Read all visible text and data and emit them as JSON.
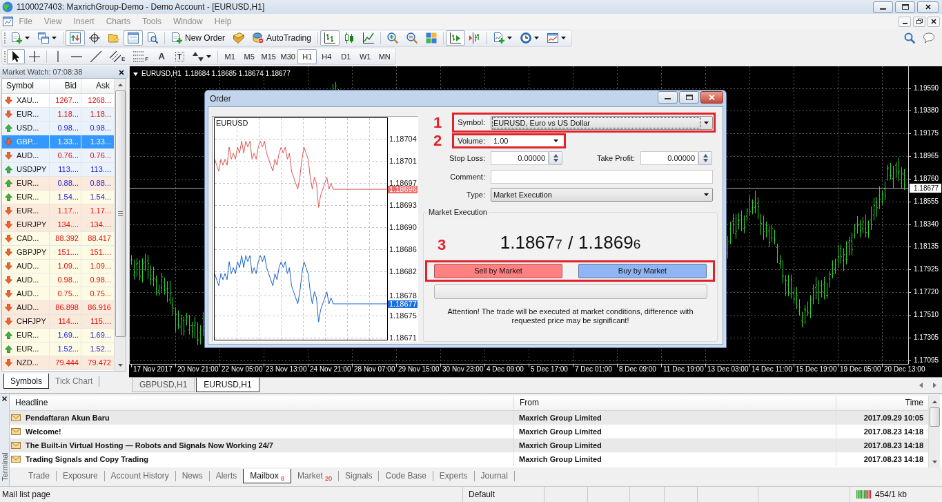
{
  "window": {
    "title": "1100027403: MaxrichGroup-Demo - Demo Account - [EURUSD,H1]"
  },
  "menu": [
    {
      "label": "File",
      "disabled": true
    },
    {
      "label": "View",
      "disabled": true
    },
    {
      "label": "Insert",
      "disabled": true
    },
    {
      "label": "Charts",
      "disabled": true
    },
    {
      "label": "Tools",
      "disabled": true
    },
    {
      "label": "Window",
      "disabled": true
    },
    {
      "label": "Help",
      "disabled": true
    }
  ],
  "main_toolbar": [
    [
      {
        "kind": "icon",
        "pressed": false
      },
      {
        "kind": "icon",
        "pressed": false
      }
    ],
    [
      {
        "kind": "icon",
        "pressed": true
      },
      {
        "kind": "icon",
        "pressed": false
      },
      {
        "kind": "icon",
        "pressed": false
      },
      {
        "kind": "icon",
        "pressed": true
      },
      {
        "kind": "icon",
        "pressed": false
      }
    ],
    [
      {
        "kind": "button",
        "label": "New Order",
        "pressed": false
      },
      {
        "kind": "icon",
        "pressed": false
      },
      {
        "kind": "button",
        "label": "AutoTrading",
        "pressed": false,
        "active": false
      }
    ],
    [
      {
        "kind": "icon",
        "pressed": true
      },
      {
        "kind": "icon",
        "pressed": false
      },
      {
        "kind": "icon",
        "pressed": false
      }
    ],
    [
      {
        "kind": "icon",
        "pressed": false
      },
      {
        "kind": "icon",
        "pressed": false
      },
      {
        "kind": "icon",
        "pressed": false
      }
    ],
    [
      {
        "kind": "icon",
        "pressed": true
      },
      {
        "kind": "icon",
        "pressed": false
      }
    ],
    [
      {
        "kind": "icon",
        "pressed": false
      },
      {
        "kind": "icon",
        "pressed": false
      },
      {
        "kind": "icon",
        "pressed": false
      }
    ]
  ],
  "drawing_toolbar": [
    [
      {
        "kind": "icon",
        "pressed": true
      },
      {
        "kind": "icon",
        "pressed": false
      }
    ],
    [
      {
        "kind": "icon",
        "pressed": false
      },
      {
        "kind": "icon",
        "pressed": false
      },
      {
        "kind": "icon",
        "pressed": false
      },
      {
        "kind": "icon",
        "pressed": false,
        "sub": "E"
      },
      {
        "kind": "icon",
        "pressed": false,
        "sub": "F"
      },
      {
        "kind": "glyph",
        "label": "A",
        "pressed": false
      },
      {
        "kind": "glyph",
        "label": "T",
        "pressed": false
      },
      {
        "kind": "icon",
        "pressed": false
      }
    ]
  ],
  "timeframes": [
    {
      "label": "M1",
      "selected": false
    },
    {
      "label": "M5",
      "selected": false
    },
    {
      "label": "M15",
      "selected": false
    },
    {
      "label": "M30",
      "selected": false
    },
    {
      "label": "H1",
      "selected": true
    },
    {
      "label": "H4",
      "selected": false
    },
    {
      "label": "D1",
      "selected": false
    },
    {
      "label": "W1",
      "selected": false
    },
    {
      "label": "MN",
      "selected": false
    }
  ],
  "market_watch": {
    "title": "Market Watch: 07:08:38",
    "columns": [
      "Symbol",
      "Bid",
      "Ask"
    ],
    "rows": [
      {
        "symbol": "XAU...",
        "bid": "1267...",
        "ask": "1268...",
        "rising": false,
        "selected": false,
        "color": "#ffffff"
      },
      {
        "symbol": "EUR...",
        "bid": "1.18...",
        "ask": "1.18...",
        "rising": false,
        "selected": false,
        "color": "#eaf2fc"
      },
      {
        "symbol": "USD...",
        "bid": "0.98...",
        "ask": "0.98...",
        "rising": true,
        "selected": false,
        "color": "#eaf2fc"
      },
      {
        "symbol": "GBP...",
        "bid": "1.33...",
        "ask": "1.33...",
        "rising": false,
        "selected": true
      },
      {
        "symbol": "AUD...",
        "bid": "0.76...",
        "ask": "0.76...",
        "rising": false,
        "selected": false,
        "color": "#eaf2fc"
      },
      {
        "symbol": "USDJPY",
        "bid": "113....",
        "ask": "113....",
        "rising": true,
        "selected": false,
        "color": "#eaf2fc"
      },
      {
        "symbol": "EUR...",
        "bid": "0.88...",
        "ask": "0.88...",
        "rising": true,
        "selected": false,
        "color": "#fbeadc"
      },
      {
        "symbol": "EUR...",
        "bid": "1.54...",
        "ask": "1.54...",
        "rising": true,
        "selected": false,
        "color": "#fefbe4"
      },
      {
        "symbol": "EUR...",
        "bid": "1.17...",
        "ask": "1.17...",
        "rising": false,
        "selected": false,
        "color": "#fbeadc"
      },
      {
        "symbol": "EURJPY",
        "bid": "134....",
        "ask": "134....",
        "rising": false,
        "selected": false,
        "color": "#fbeadc"
      },
      {
        "symbol": "CAD...",
        "bid": "88.392",
        "ask": "88.417",
        "rising": false,
        "selected": false,
        "color": "#fefbe4"
      },
      {
        "symbol": "GBPJPY",
        "bid": "151....",
        "ask": "151....",
        "rising": false,
        "selected": false,
        "color": "#fefbe4"
      },
      {
        "symbol": "AUD...",
        "bid": "1.09...",
        "ask": "1.09...",
        "rising": false,
        "selected": false,
        "color": "#fefbe4"
      },
      {
        "symbol": "AUD...",
        "bid": "0.98...",
        "ask": "0.98...",
        "rising": false,
        "selected": false,
        "color": "#fefbe4"
      },
      {
        "symbol": "AUD...",
        "bid": "0.75...",
        "ask": "0.75...",
        "rising": false,
        "selected": false,
        "color": "#fefbe4"
      },
      {
        "symbol": "AUD...",
        "bid": "86.898",
        "ask": "86.916",
        "rising": false,
        "selected": false,
        "color": "#fbeadc"
      },
      {
        "symbol": "CHFJPY",
        "bid": "114....",
        "ask": "115....",
        "rising": false,
        "selected": false,
        "color": "#fbeadc"
      },
      {
        "symbol": "EUR...",
        "bid": "1.69...",
        "ask": "1.69...",
        "rising": true,
        "selected": false,
        "color": "#fefbe4"
      },
      {
        "symbol": "EUR...",
        "bid": "1.52...",
        "ask": "1.52...",
        "rising": true,
        "selected": false,
        "color": "#fefbe4"
      },
      {
        "symbol": "NZD...",
        "bid": "79.444",
        "ask": "79.472",
        "rising": false,
        "selected": false,
        "color": "#fbeadc"
      }
    ],
    "tabs": [
      {
        "label": "Symbols",
        "selected": true
      },
      {
        "label": "Tick Chart",
        "selected": false
      }
    ]
  },
  "chart": {
    "symbol": "EURUSD,H1",
    "ohlc": "1.18684 1.18685 1.18674 1.18677",
    "price_labels": [
      "1.19590",
      "1.19380",
      "1.19175",
      "1.18965",
      "1.18760",
      "1.18555",
      "1.18340",
      "1.18135",
      "1.17925",
      "1.17720",
      "1.17510",
      "1.17305",
      "1.17095"
    ],
    "current_price": "1.18677",
    "time_labels": [
      "17 Nov 2017",
      "20 Nov 21:00",
      "22 Nov 05:00",
      "23 Nov 13:00",
      "24 Nov 21:00",
      "28 Nov 07:00",
      "29 Nov 15:00",
      "30 Nov 23:00",
      "4 Dec 09:00",
      "5 Dec 17:00",
      "7 Dec 01:00",
      "8 Dec 09:00",
      "11 Dec 19:00",
      "13 Dec 03:00",
      "14 Dec 11:00",
      "15 Dec 19:00",
      "19 Dec 05:00",
      "20 Dec 13:00"
    ]
  },
  "chart_tabs": [
    {
      "label": "GBPUSD,H1",
      "selected": false
    },
    {
      "label": "EURUSD,H1",
      "selected": true
    }
  ],
  "order_dialog": {
    "title": "Order",
    "tick_chart": {
      "chart_data": {
        "type": "line",
        "title": "EURUSD",
        "grid": true,
        "ylim": [
          1.1867104,
          1.1870793
        ],
        "yticks": [
          {
            "value": 1.1870438,
            "label": "1.18704"
          },
          {
            "value": 1.1870071,
            "label": "1.18701"
          },
          {
            "value": 1.1869705,
            "label": "1.18697"
          },
          {
            "value": 1.1869338,
            "label": "1.18693"
          },
          {
            "value": 1.1868971,
            "label": "1.18690"
          },
          {
            "value": 1.1868605,
            "label": "1.18686"
          },
          {
            "value": 1.1868238,
            "label": "1.18682"
          },
          {
            "value": 1.186784,
            "label": "1.18678"
          },
          {
            "value": 1.1867505,
            "label": "1.18675"
          },
          {
            "value": 1.1867138,
            "label": "1.18671"
          }
        ],
        "series": [
          {
            "color": "#e05555",
            "values": [
              1.18701,
              1.187,
              1.18699,
              1.18701,
              1.187,
              1.18701,
              1.187,
              1.18703,
              1.18701,
              1.18702,
              1.18701,
              1.18703,
              1.18702,
              1.18704,
              1.18702,
              1.18704,
              1.18703,
              1.18704,
              1.18701,
              1.18702,
              1.18701,
              1.18703,
              1.18704,
              1.18703,
              1.18704,
              1.18702,
              1.18701,
              1.187,
              1.18699,
              1.18701,
              1.187,
              1.18702,
              1.18703,
              1.18702,
              1.18703,
              1.18701,
              1.18702,
              1.18699,
              1.18698,
              1.18697,
              1.18696,
              1.18698,
              1.18701,
              1.18703,
              1.18702,
              1.18701,
              1.18698,
              1.18696,
              1.18698,
              1.18697,
              1.18693,
              1.18695,
              1.18696,
              1.18697,
              1.18698,
              1.18696,
              1.18697,
              1.18696,
              1.18696,
              1.18696,
              1.18696,
              1.18696,
              1.18696,
              1.18696,
              1.18696,
              1.18696,
              1.18696,
              1.18696,
              1.18696,
              1.18696,
              1.18696,
              1.18696,
              1.18696,
              1.18696,
              1.18696,
              1.18696,
              1.18696,
              1.18696,
              1.18696,
              1.18696,
              1.18696,
              1.18696,
              1.18696,
              1.18696
            ]
          },
          {
            "color": "#1a5fd0",
            "values": [
              1.18682,
              1.18681,
              1.1868,
              1.18682,
              1.18681,
              1.18682,
              1.18681,
              1.18684,
              1.18682,
              1.18683,
              1.18682,
              1.18684,
              1.18683,
              1.18685,
              1.18683,
              1.18685,
              1.18684,
              1.18685,
              1.18682,
              1.18683,
              1.18682,
              1.18684,
              1.18685,
              1.18684,
              1.18685,
              1.18683,
              1.18682,
              1.18681,
              1.1868,
              1.18682,
              1.18681,
              1.18683,
              1.18684,
              1.18683,
              1.18684,
              1.18682,
              1.18683,
              1.1868,
              1.18679,
              1.18678,
              1.18677,
              1.18679,
              1.18682,
              1.18684,
              1.18683,
              1.18682,
              1.18679,
              1.18677,
              1.18679,
              1.18678,
              1.18674,
              1.18676,
              1.18677,
              1.18678,
              1.18679,
              1.18677,
              1.18678,
              1.18677,
              1.18677,
              1.18677,
              1.18677,
              1.18677,
              1.18677,
              1.18677,
              1.18677,
              1.18677,
              1.18677,
              1.18677,
              1.18677,
              1.18677,
              1.18677,
              1.18677,
              1.18677,
              1.18677,
              1.18677,
              1.18677,
              1.18677,
              1.18677,
              1.18677,
              1.18677,
              1.18677,
              1.18677,
              1.18677,
              1.18677
            ]
          }
        ]
      },
      "ask": "1.18696",
      "bid": "1.18677"
    },
    "symbol": {
      "label": "Symbol:",
      "value": "EURUSD, Euro vs US Dollar",
      "focused": true,
      "marker": "1"
    },
    "volume": {
      "label": "Volume:",
      "value": "1.00",
      "marker": "2"
    },
    "stop_loss": {
      "label": "Stop Loss:",
      "value": "0.00000"
    },
    "take_profit": {
      "label": "Take Profit:",
      "value": "0.00000"
    },
    "comment": {
      "label": "Comment:"
    },
    "type": {
      "label": "Type:",
      "value": "Market Execution"
    },
    "execution": {
      "title": "Market Execution",
      "bid": "1.1867",
      "bid_pip": "7",
      "separator": "/",
      "ask": "1.1869",
      "ask_pip": "6",
      "marker": "3",
      "buttons": [
        {
          "kind": "sell",
          "label": "Sell by Market"
        },
        {
          "kind": "buy",
          "label": "Buy by Market"
        }
      ],
      "notice": "Attention! The trade will be executed at market conditions, difference with requested price may be significant!"
    }
  },
  "terminal": {
    "title": "Terminal",
    "columns": [
      "Headline",
      "From",
      "Time"
    ],
    "rows": [
      {
        "headline": "Pendaftaran Akun Baru",
        "from": "Maxrich Group Limited",
        "time": "2017.09.29 10:05"
      },
      {
        "headline": "Welcome!",
        "from": "Maxrich Group Limited",
        "time": "2017.08.23 14:18"
      },
      {
        "headline": "The Built-in Virtual Hosting — Robots and Signals Now Working 24/7",
        "from": "Maxrich Group Limited",
        "time": "2017.08.23 14:18"
      },
      {
        "headline": "Trading Signals and Copy Trading",
        "from": "Maxrich Group Limited",
        "time": "2017.08.23 14:18"
      }
    ],
    "tabs": [
      {
        "label": "Trade",
        "selected": false
      },
      {
        "label": "Exposure",
        "selected": false
      },
      {
        "label": "Account History",
        "selected": false
      },
      {
        "label": "News",
        "selected": false
      },
      {
        "label": "Alerts",
        "selected": false
      },
      {
        "label": "Mailbox",
        "count": "8",
        "selected": true
      },
      {
        "label": "Market",
        "count": "20",
        "selected": false
      },
      {
        "label": "Signals",
        "selected": false
      },
      {
        "label": "Code Base",
        "selected": false
      },
      {
        "label": "Experts",
        "selected": false
      },
      {
        "label": "Journal",
        "selected": false
      }
    ]
  },
  "status_bar": {
    "message": "Mail list page",
    "profile": "Default",
    "traffic": "454/1 kb"
  }
}
